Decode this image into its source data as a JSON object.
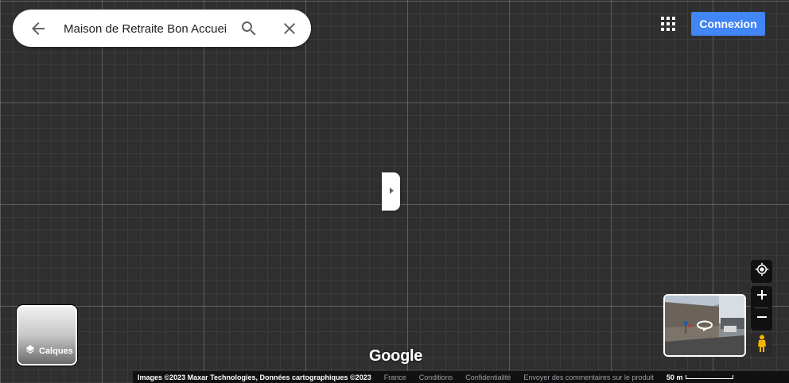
{
  "search": {
    "value": "Maison de Retraite Bon Accuei"
  },
  "header": {
    "signin_label": "Connexion"
  },
  "layers": {
    "label": "Calques"
  },
  "map": {
    "logo": "Google"
  },
  "footer": {
    "attribution": "Images ©2023 Maxar Technologies, Données cartographiques ©2023",
    "links": [
      "France",
      "Conditions",
      "Confidentialité",
      "Envoyer des commentaires sur le produit"
    ],
    "scale": "50 m"
  },
  "icons": [
    "arrow-back-icon",
    "search-icon",
    "close-icon",
    "apps-grid-icon",
    "chevron-right-icon",
    "layers-icon",
    "my-location-icon",
    "zoom-in-icon",
    "zoom-out-icon",
    "pegman-icon",
    "rotate-360-icon"
  ],
  "colors": {
    "signin": "#4285f4",
    "map_bg": "#2f2f2f",
    "controls": "#111111"
  }
}
